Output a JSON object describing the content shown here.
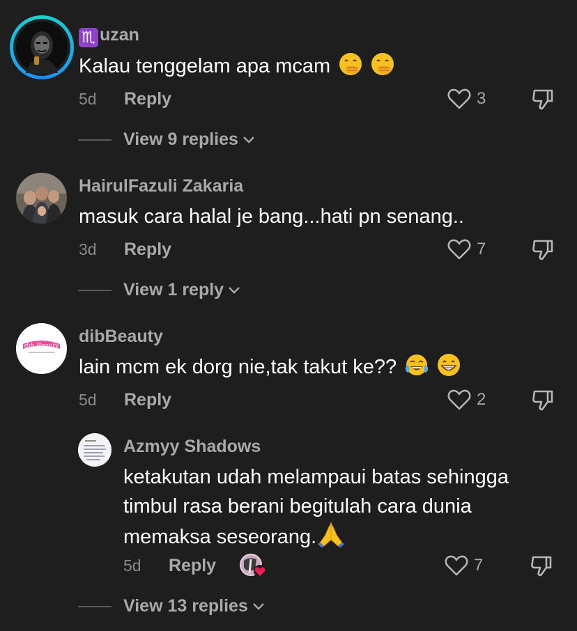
{
  "comments": [
    {
      "username_sign": "♏",
      "username": "uzan",
      "text": "Kalau tenggelam apa mcam",
      "emojis": [
        "hand-over-mouth-emoji",
        "hand-over-mouth-emoji"
      ],
      "age": "5d",
      "reply_label": "Reply",
      "likes": "3",
      "view_replies": "View 9 replies"
    },
    {
      "username": "HairulFazuli Zakaria",
      "text": "masuk cara halal je bang...hati pn senang..",
      "age": "3d",
      "reply_label": "Reply",
      "likes": "7",
      "view_replies": "View 1 reply"
    },
    {
      "username": "dibBeauty",
      "text": "lain mcm ek dorg nie,tak takut ke??",
      "emojis": [
        "tears-of-joy-emoji",
        "grinning-emoji"
      ],
      "age": "5d",
      "reply_label": "Reply",
      "likes": "2"
    }
  ],
  "reply": {
    "username": "Azmyy Shadows",
    "lines": [
      "ketakutan udah melampaui batas sehingga",
      "timbul rasa berani begitulah cara dunia",
      "memaksa seseorang."
    ],
    "emoji": "folded-hands-emoji",
    "age": "5d",
    "reply_label": "Reply",
    "likes": "7",
    "view_replies": "View 13 replies"
  },
  "colors": {
    "background": "#1e1e1e",
    "secondary_text": "#a9a9a9",
    "story_ring": "#19d6c8"
  }
}
